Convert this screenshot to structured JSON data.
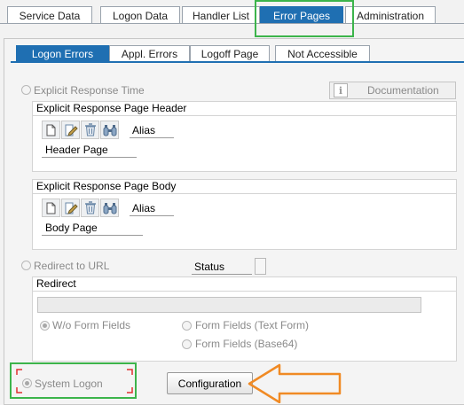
{
  "tabs": [
    {
      "label": "Service Data",
      "active": false
    },
    {
      "label": "Logon Data",
      "active": false
    },
    {
      "label": "Handler List",
      "active": false
    },
    {
      "label": "Error Pages",
      "active": true
    },
    {
      "label": "Administration",
      "active": false
    }
  ],
  "subtabs": [
    {
      "label": "Logon Errors",
      "active": true
    },
    {
      "label": "Appl. Errors",
      "active": false
    },
    {
      "label": "Logoff Page",
      "active": false
    },
    {
      "label": "Not Accessible",
      "active": false
    }
  ],
  "explicit": {
    "radio_label": "Explicit Response Time",
    "documentation_label": "Documentation",
    "header_group": {
      "title": "Explicit Response Page Header",
      "alias_label": "Alias",
      "page_label": "Header Page"
    },
    "body_group": {
      "title": "Explicit Response Page Body",
      "alias_label": "Alias",
      "page_label": "Body Page"
    }
  },
  "redirect": {
    "radio_label": "Redirect to URL",
    "status_label": "Status",
    "group_title": "Redirect",
    "options": {
      "without_form_fields": "W/o Form Fields",
      "form_fields_text": "Form Fields (Text Form)",
      "form_fields_base64": "Form Fields (Base64)"
    }
  },
  "system_logon": {
    "radio_label": "System Logon",
    "configuration_label": "Configuration"
  },
  "colors": {
    "accent_blue": "#1f6fb2",
    "highlight_green": "#3cb44b",
    "arrow_orange": "#f08a24",
    "focus_red": "#e03030"
  },
  "icons": [
    "new-document-icon",
    "edit-pencil-icon",
    "delete-trash-icon",
    "binoculars-icon",
    "info-icon"
  ]
}
